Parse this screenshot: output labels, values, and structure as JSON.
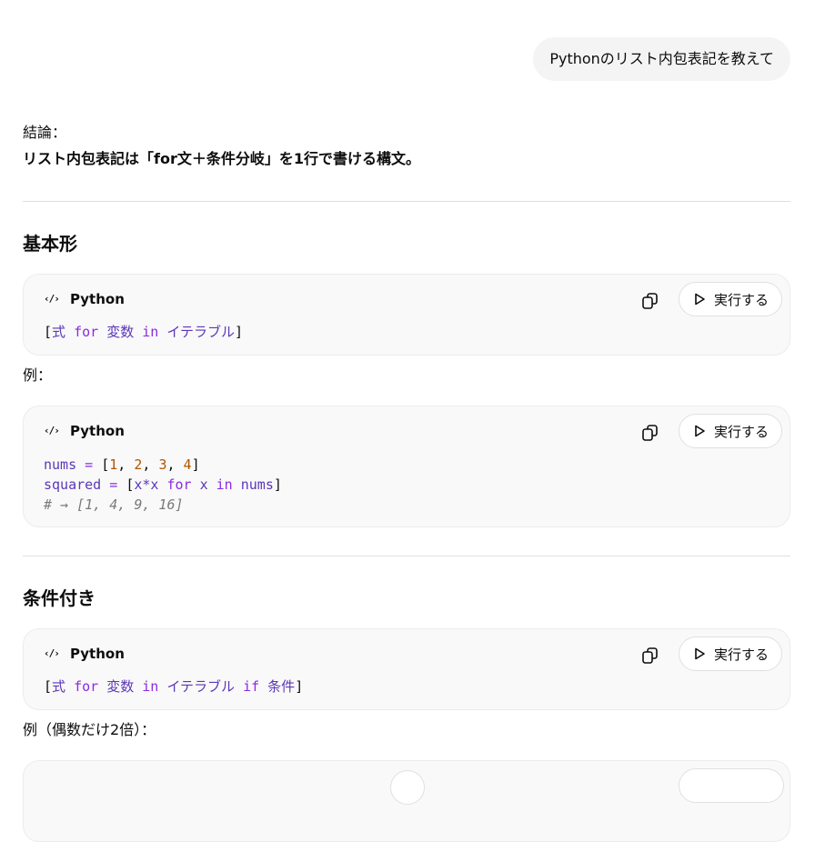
{
  "user_message": "Pythonのリスト内包表記を教えて",
  "conclusion": {
    "label": "結論：",
    "text": "リスト内包表記は「for文＋条件分岐」を1行で書ける構文。"
  },
  "sections": [
    {
      "title": "基本形",
      "code_blocks": [
        {
          "language": "Python",
          "copy_icon": "copy-icon",
          "run_label": "実行する",
          "tokens": {
            "open": "[",
            "expr": "式",
            "for": "for",
            "var": "変数",
            "in": "in",
            "iter": "イテラブル",
            "close": "]"
          }
        }
      ],
      "example_label": "例：",
      "example_block": {
        "language": "Python",
        "run_label": "実行する",
        "lines": {
          "l1_name": "nums",
          "l1_eq": "=",
          "l1_open": "[",
          "n1": "1",
          "n2": "2",
          "n3": "3",
          "n4": "4",
          "l1_close": "]",
          "l2_name": "squared",
          "l2_eq": "=",
          "l2_open": "[",
          "l2_expr": "x*x",
          "l2_for": "for",
          "l2_x": "x",
          "l2_in": "in",
          "l2_nums": "nums",
          "l2_close": "]",
          "l3_comment": "# → [1, 4, 9, 16]"
        }
      }
    },
    {
      "title": "条件付き",
      "code_blocks": [
        {
          "language": "Python",
          "run_label": "実行する",
          "tokens": {
            "open": "[",
            "expr": "式",
            "for": "for",
            "var": "変数",
            "in": "in",
            "iter": "イテラブル",
            "if": "if",
            "cond": "条件",
            "close": "]"
          }
        }
      ],
      "example_label": "例（偶数だけ2倍）："
    }
  ],
  "icons": {
    "code": "code-icon",
    "copy": "copy-icon",
    "play": "play-icon"
  }
}
